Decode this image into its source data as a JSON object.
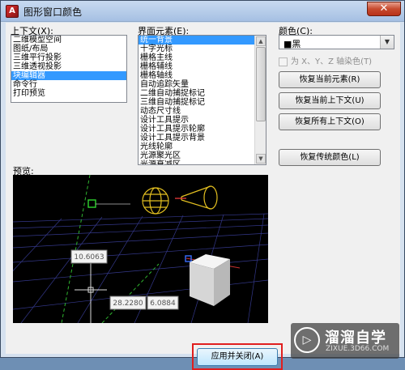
{
  "window": {
    "title": "图形窗口颜色",
    "close_symbol": "✕"
  },
  "context": {
    "label": "上下文(X):",
    "items": [
      "二维模型空间",
      "图纸/布局",
      "三维平行投影",
      "三维透视投影",
      "块编辑器",
      "命令行",
      "打印预览"
    ],
    "selected_index": 4
  },
  "interface_element": {
    "label": "界面元素(E):",
    "items": [
      "统一背景",
      "十字光标",
      "栅格主线",
      "栅格辅线",
      "栅格轴线",
      "自动追踪矢量",
      "二维自动捕捉标记",
      "三维自动捕捉标记",
      "动态尺寸线",
      "设计工具提示",
      "设计工具提示轮廓",
      "设计工具提示背景",
      "光线轮廓",
      "光源聚光区",
      "光源衰减区"
    ],
    "selected_index": 0
  },
  "color": {
    "label": "颜色(C):",
    "value": "■黑",
    "checkbox_label": "为 X、Y、Z 轴染色(T)",
    "checkbox_checked": false
  },
  "buttons": {
    "restore_current_element": "恢复当前元素(R)",
    "restore_current_context": "恢复当前上下文(U)",
    "restore_all_contexts": "恢复所有上下文(O)",
    "restore_classic_colors": "恢复传统颜色(L)",
    "apply_close": "应用并关闭(A)"
  },
  "preview": {
    "label": "预览:",
    "dim_vertical": "10.6063",
    "dim_horizontal_1": "28.2280",
    "dim_horizontal_2": "6.0884"
  },
  "watermark": {
    "name": "溜溜自学",
    "url": "ZIXUE.3D66.COM"
  },
  "colors": {
    "title_bar": "#a6c0e3",
    "selection": "#3399ff",
    "preview_bg": "#000000",
    "highlight": "#e01e1e",
    "grid": "#3a3f8f"
  }
}
